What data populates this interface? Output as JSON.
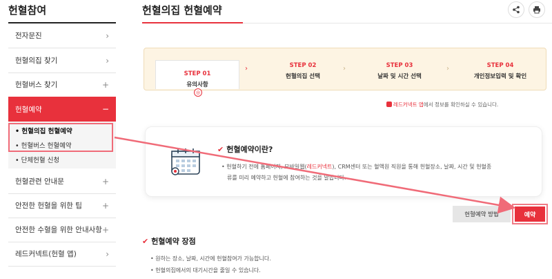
{
  "sidebar": {
    "title": "헌혈참여",
    "items": [
      {
        "label": "전자문진",
        "arrow": "›"
      },
      {
        "label": "헌혈의집 찾기",
        "arrow": "›"
      },
      {
        "label": "헌혈버스 찾기",
        "arrow": "+"
      },
      {
        "label": "헌혈예약",
        "arrow": "−"
      },
      {
        "label": "헌혈관련 안내문",
        "arrow": "+"
      },
      {
        "label": "안전한 헌혈을 위한 팁",
        "arrow": "+"
      },
      {
        "label": "안전한 수혈을 위한 안내사항",
        "arrow": "+"
      },
      {
        "label": "레드커넥트(헌혈 앱)",
        "arrow": "›"
      }
    ],
    "subitems": [
      {
        "label": "• 헌혈의집 헌혈예약"
      },
      {
        "label": "• 헌혈버스 헌혈예약"
      },
      {
        "label": "• 단체헌혈 신청"
      }
    ]
  },
  "header": {
    "title": "헌혈의집 헌혈예약",
    "share_icon": "share-icon",
    "print_icon": "print-icon"
  },
  "steps": [
    {
      "label": "STEP 01",
      "name": "유의사항"
    },
    {
      "label": "STEP 02",
      "name": "헌혈의집 선택"
    },
    {
      "label": "STEP 03",
      "name": "날짜 및 시간 선택"
    },
    {
      "label": "STEP 04",
      "name": "개인정보입력 및 확인"
    }
  ],
  "app_note": {
    "highlight": "레드커넥트 앱",
    "text": "에서 정보를 확인하실 수 있습니다."
  },
  "info": {
    "title": "헌혈예약이란?",
    "body_pre": "• 헌혈하기 전에 홈페이지, 모바일웹(",
    "body_link": "레드커넥트",
    "body_post": "), CRM센터 또는 혈액원 직원을 통해 헌혈장소, 날짜, 시간 및 헌혈종",
    "body_line2": "류를 미리 예약하고 헌혈에 참여하는 것을 말합니다."
  },
  "buttons": {
    "method": "헌혈예약 방법",
    "reserve": "예약"
  },
  "advantages": {
    "title": "헌혈예약 장점",
    "items": [
      "• 원하는 장소, 날짜, 시간에 헌혈참여가 가능합니다.",
      "• 헌혈의집에서의 대기시간을 줄일 수 있습니다."
    ]
  },
  "colors": {
    "accent": "#e8313c",
    "highlight": "#f06b78",
    "step_bg": "#fdf4e3"
  }
}
